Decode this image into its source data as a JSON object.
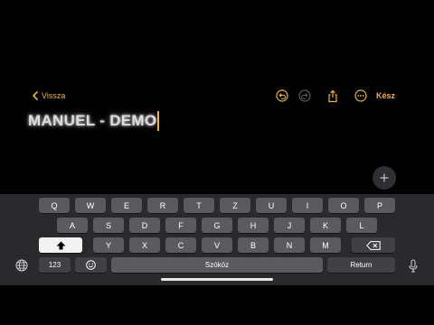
{
  "nav": {
    "back_label": "Vissza",
    "done_label": "Kész"
  },
  "note": {
    "title": "MANUEL - DEMO"
  },
  "keyboard": {
    "row1": [
      "Q",
      "W",
      "E",
      "R",
      "T",
      "Z",
      "U",
      "I",
      "O",
      "P"
    ],
    "row2": [
      "A",
      "S",
      "D",
      "F",
      "G",
      "H",
      "J",
      "K",
      "L"
    ],
    "row3": [
      "Y",
      "X",
      "C",
      "V",
      "B",
      "N",
      "M"
    ],
    "numbers_label": "123",
    "space_label": "Szóköz",
    "return_label": "Return"
  },
  "colors": {
    "accent": "#f0b33a",
    "key": "#5b5b5f",
    "keyboard_bg": "#2a2a2d"
  },
  "icons": [
    "chevron-left-icon",
    "undo-icon",
    "redo-icon",
    "share-icon",
    "more-icon",
    "plus-icon",
    "shift-icon",
    "delete-icon",
    "emoji-icon",
    "globe-icon",
    "microphone-icon"
  ]
}
